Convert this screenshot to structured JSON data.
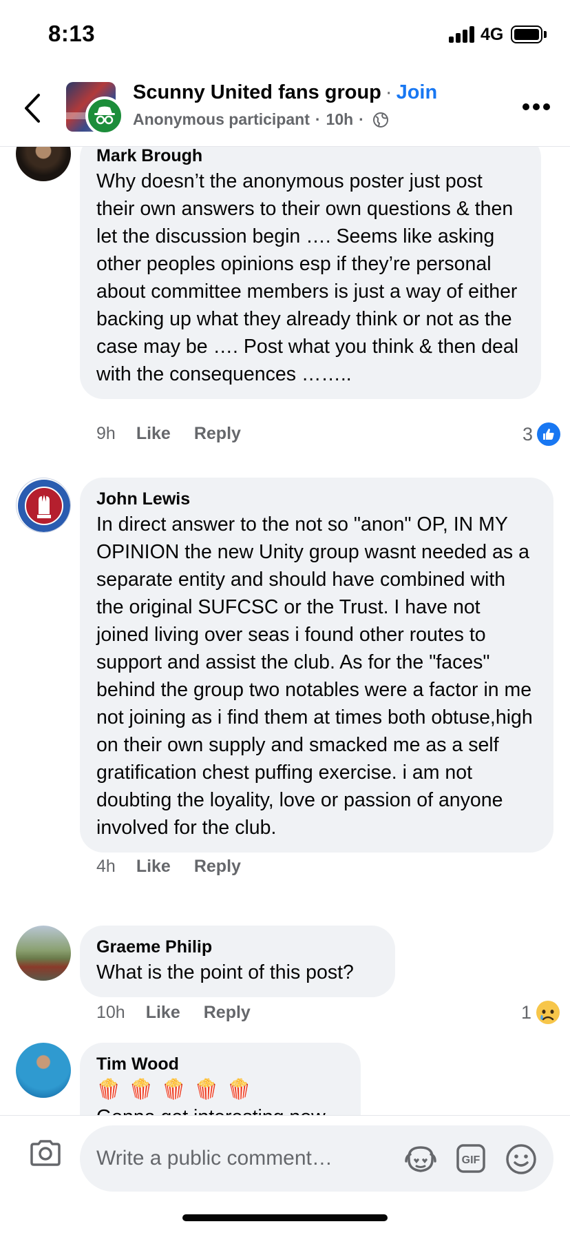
{
  "status_bar": {
    "time": "8:13",
    "network": "4G"
  },
  "header": {
    "group_name": "Scunny United fans group",
    "separator": "·",
    "join_label": "Join",
    "author": "Anonymous participant",
    "age": "10h",
    "back_icon": "chevron-left-icon",
    "more_icon": "more-dots-icon",
    "privacy_icon": "globe-icon"
  },
  "comments": [
    {
      "author": "Mark Brough",
      "text": "Why doesn’t the anonymous poster just post their own answers to their own questions & then let the discussion begin …. Seems like asking other peoples opinions esp if they’re personal about committee members is just a way of either backing up what they already think or not as the case may be …. Post what you think & then deal with the  consequences ……..",
      "time": "9h",
      "like_label": "Like",
      "reply_label": "Reply",
      "reaction_count": "3",
      "reaction_icon": "like-reaction-icon"
    },
    {
      "author": "John Lewis",
      "text": "In direct answer to the not so \"anon\" OP, IN MY OPINION the new Unity group wasnt needed  as a separate entity  and should have combined with the original SUFCSC or the Trust. I have not joined living over seas i found other routes to support and assist the club. As for the \"faces\" behind the group two notables were a factor in me not joining as i find them at times both obtuse,high on their own supply and smacked me as a self gratification chest puffing exercise. i am not doubting the loyality, love or passion of anyone involved for the club.",
      "time": "4h",
      "like_label": "Like",
      "reply_label": "Reply"
    },
    {
      "author": "Graeme Philip",
      "text": "What is the point of this post?",
      "time": "10h",
      "like_label": "Like",
      "reply_label": "Reply",
      "reaction_count": "1",
      "reaction_icon": "sad-reaction-icon"
    },
    {
      "author": "Tim Wood",
      "emoji": "🍿 🍿 🍿 🍿 🍿",
      "text": "Gonna get interesting now"
    }
  ],
  "composer": {
    "placeholder": "Write a public comment…",
    "camera_icon": "camera-icon",
    "avatar_sticker_icon": "avatar-sticker-icon",
    "gif_label": "GIF",
    "emoji_icon": "emoji-icon"
  },
  "colors": {
    "accent": "#1877f2",
    "bubble": "#f0f2f5",
    "secondary_text": "#65676b",
    "anon_badge": "#1c8d3a"
  }
}
